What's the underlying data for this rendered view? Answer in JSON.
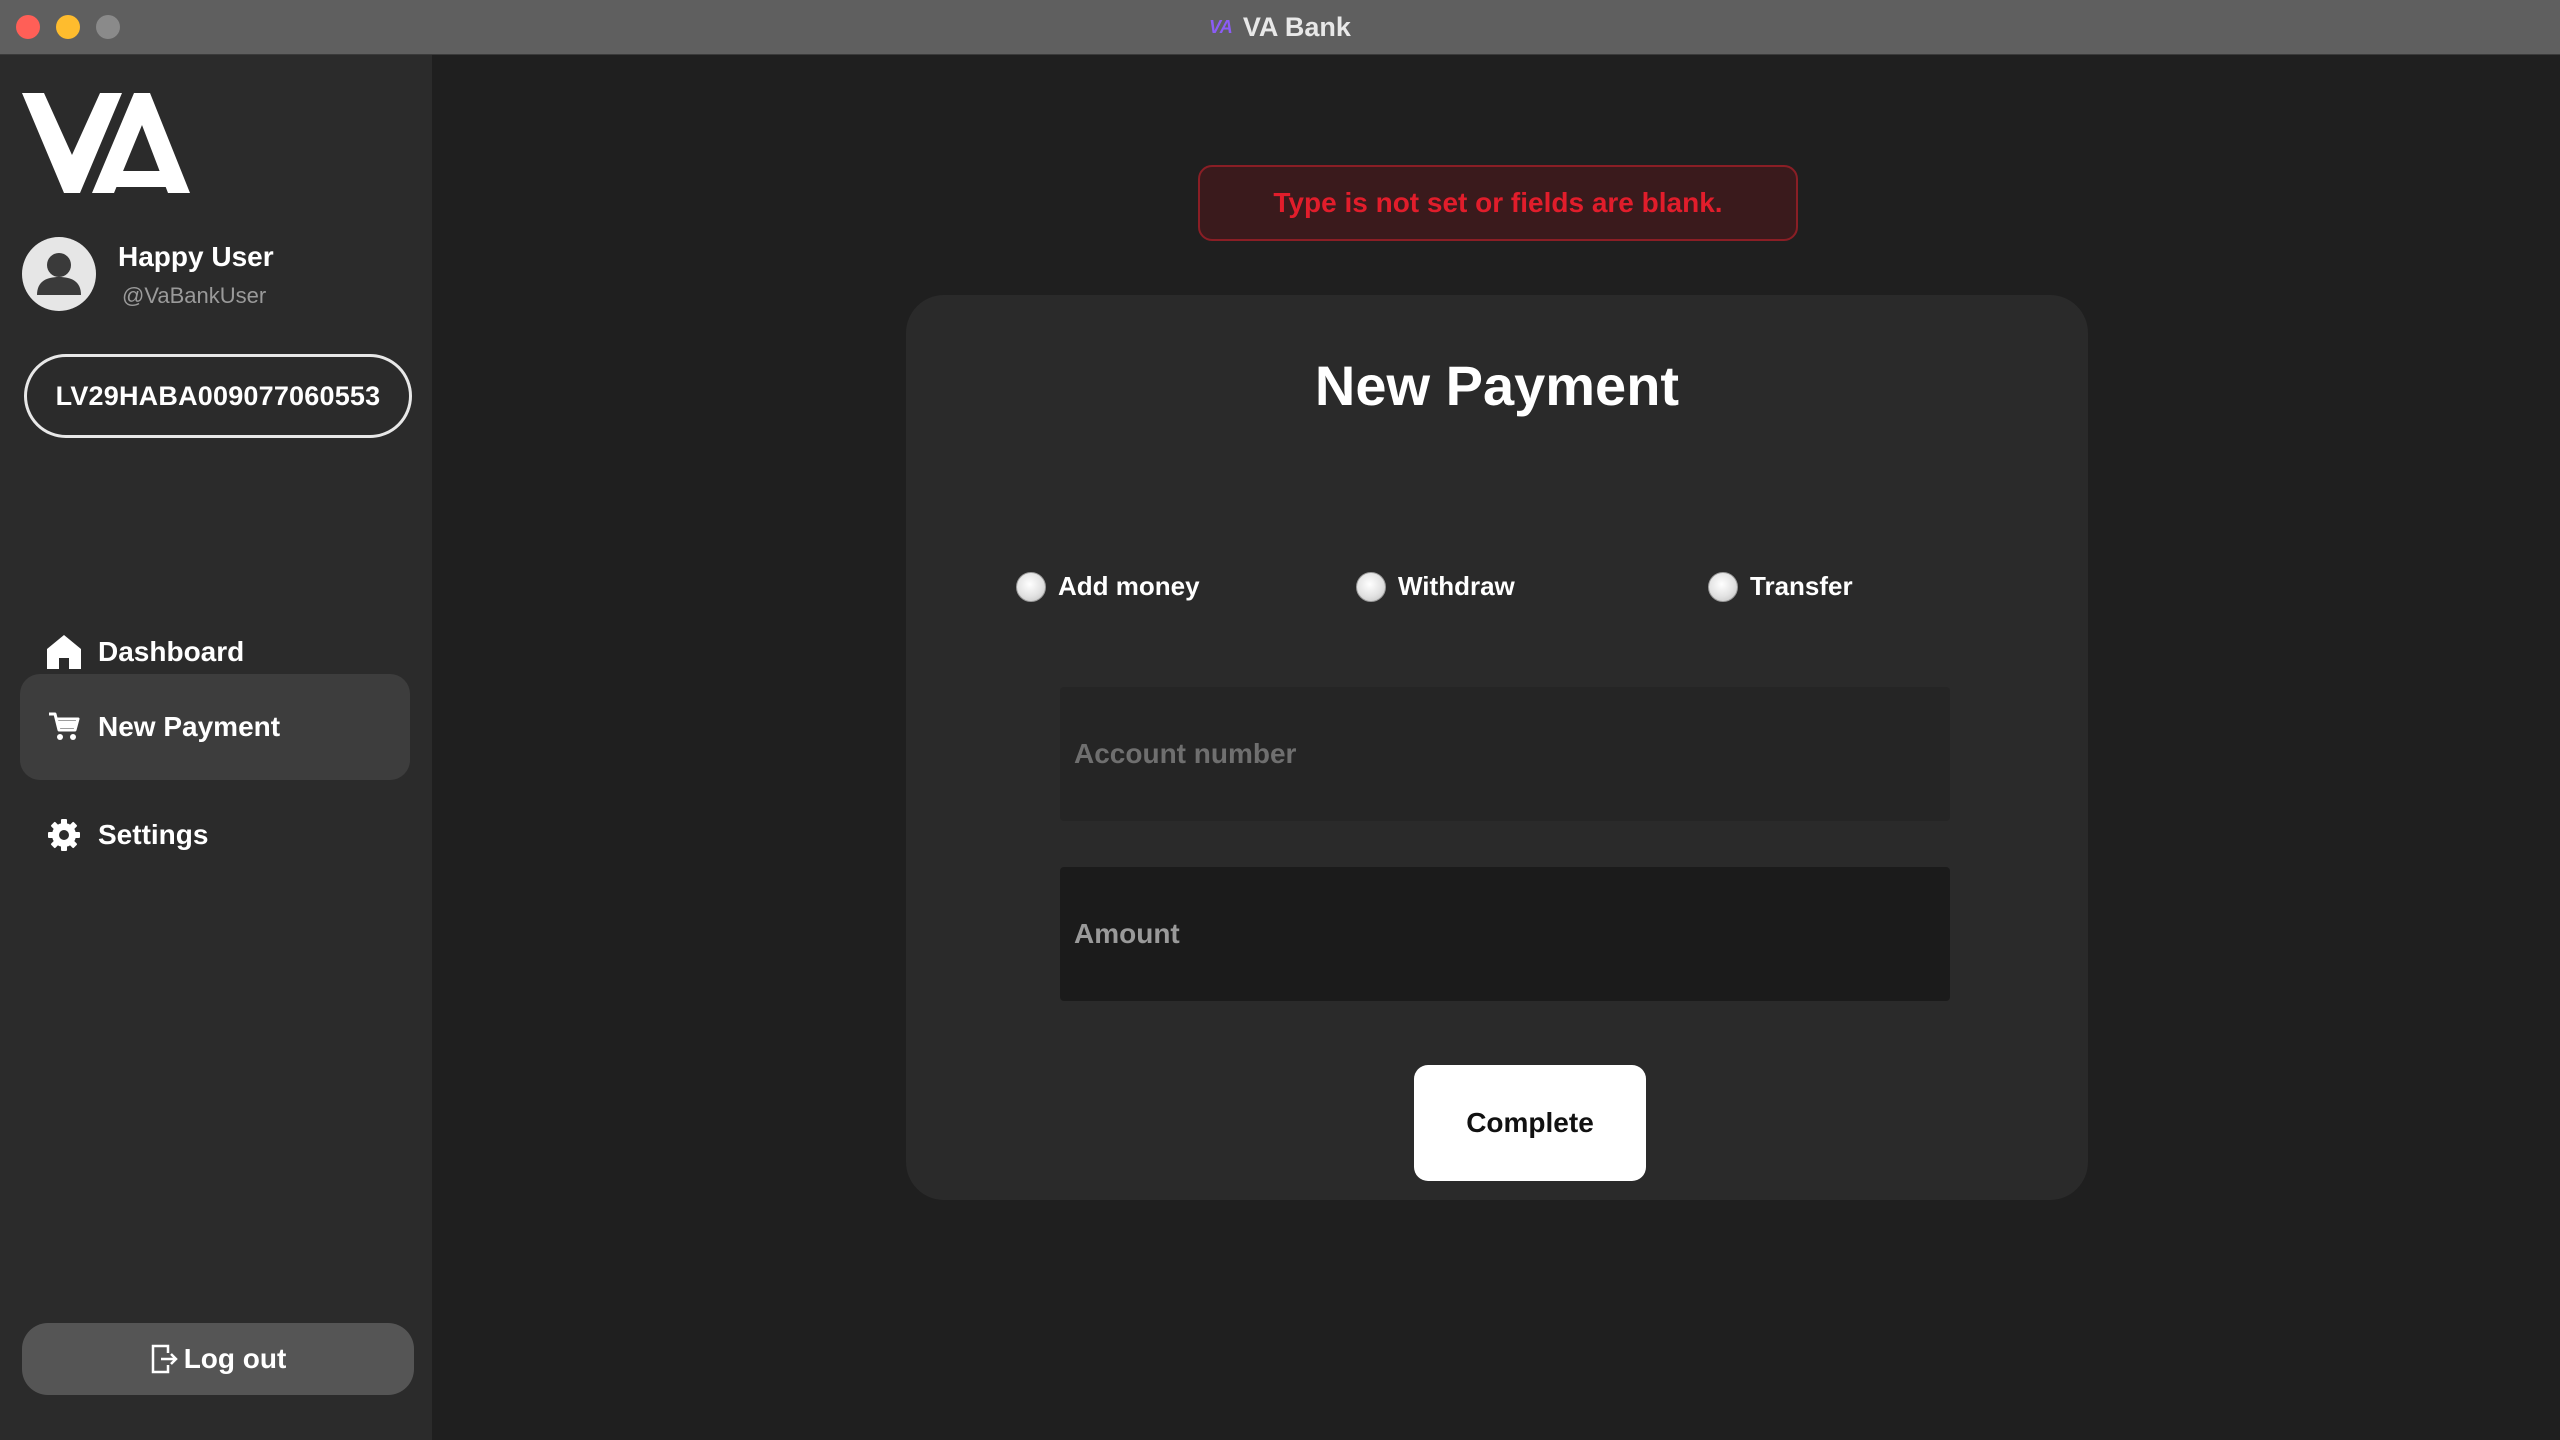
{
  "window": {
    "title": "VA Bank",
    "title_logo": "VA"
  },
  "sidebar": {
    "logo_text": "VA",
    "user": {
      "name": "Happy User",
      "handle": "@VaBankUser"
    },
    "account_iban": "LV29HABA009077060553",
    "nav": [
      {
        "label": "Dashboard",
        "icon": "home-icon",
        "active": false
      },
      {
        "label": "New Payment",
        "icon": "cart-icon",
        "active": true
      },
      {
        "label": "Settings",
        "icon": "gear-icon",
        "active": false
      }
    ],
    "logout_label": "Log out"
  },
  "main": {
    "error_message": "Type is not set or fields are blank.",
    "card": {
      "title": "New Payment",
      "radios": [
        {
          "label": "Add money",
          "checked": false
        },
        {
          "label": "Withdraw",
          "checked": false
        },
        {
          "label": "Transfer",
          "checked": false
        }
      ],
      "account_field": {
        "placeholder": "Account number",
        "value": ""
      },
      "amount_field": {
        "placeholder": "Amount",
        "value": ""
      },
      "submit_label": "Complete"
    }
  },
  "colors": {
    "error_text": "#e11d2b",
    "sidebar_bg": "#2b2b2b",
    "main_bg": "#1f1f1f",
    "card_bg": "#2a2a2a"
  }
}
